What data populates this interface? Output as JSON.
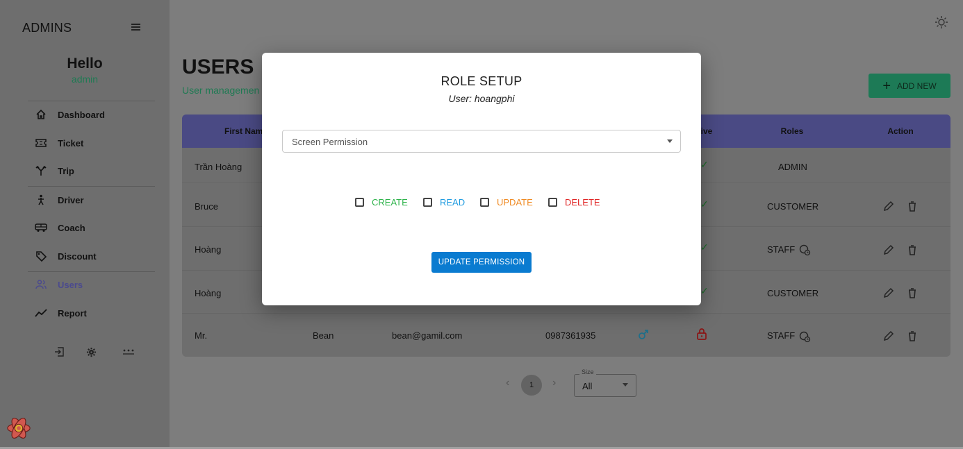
{
  "sidebar": {
    "brand": "ADMINS",
    "greeting": "Hello",
    "username": "admin",
    "items": [
      {
        "label": "Dashboard",
        "icon": "home-icon"
      },
      {
        "label": "Ticket",
        "icon": "ticket-icon"
      },
      {
        "label": "Trip",
        "icon": "fork-icon"
      },
      {
        "label": "Driver",
        "icon": "person-walking-icon"
      },
      {
        "label": "Coach",
        "icon": "bus-icon"
      },
      {
        "label": "Discount",
        "icon": "tag-icon"
      },
      {
        "label": "Users",
        "icon": "people-icon",
        "active": true
      },
      {
        "label": "Report",
        "icon": "trend-icon"
      }
    ]
  },
  "header": {
    "title": "USERS",
    "subtitle": "User managemen",
    "add_new_label": "ADD NEW"
  },
  "table": {
    "columns": [
      "First Name",
      "tive",
      "Roles",
      "Action"
    ],
    "rows": [
      {
        "first": "Trần Hoàng",
        "role": "ADMIN"
      },
      {
        "first": "Bruce",
        "role": "CUSTOMER"
      },
      {
        "first": "Hoàng",
        "role": "STAFF"
      },
      {
        "first": "Hoàng",
        "role": "CUSTOMER"
      },
      {
        "first": "Mr.",
        "last": "Bean",
        "email": "bean@gamil.com",
        "phone": "0987361935",
        "role": "STAFF"
      }
    ]
  },
  "pagination": {
    "page": "1",
    "size_label": "Size",
    "size_value": "All"
  },
  "modal": {
    "title": "ROLE SETUP",
    "user_line": "User: hoangphi",
    "select_placeholder": "Screen Permission",
    "permissions": [
      {
        "label": "CREATE",
        "color": "#2db34a"
      },
      {
        "label": "READ",
        "color": "#1e9be0"
      },
      {
        "label": "UPDATE",
        "color": "#ef8a22"
      },
      {
        "label": "DELETE",
        "color": "#e02424"
      }
    ],
    "button_label": "UPDATE PERMISSION"
  },
  "colors": {
    "accent": "#0a7bd0",
    "table_header": "#4a4a84",
    "add_button": "#1d7a56"
  }
}
